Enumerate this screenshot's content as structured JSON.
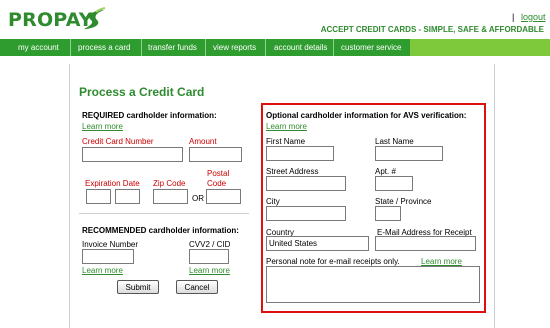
{
  "brand": {
    "name": "PROPAY",
    "tagline": "ACCEPT CREDIT CARDS - SIMPLE, SAFE & AFFORDABLE",
    "green": "#2e8b2e",
    "nav_green": "#2f9c2f",
    "accent_red": "#e01010",
    "error_red": "#cc0000"
  },
  "header": {
    "separator": "|",
    "logout": "logout"
  },
  "nav": {
    "items": [
      "my account",
      "process a card",
      "transfer funds",
      "view reports",
      "account details",
      "customer service"
    ]
  },
  "page": {
    "title": "Process a Credit Card"
  },
  "required": {
    "heading": "REQUIRED cardholder information:",
    "learn_more": "Learn more",
    "card_number_label": "Credit Card Number",
    "amount_label": "Amount",
    "expiration_label": "Expiration Date",
    "zip_label": "Zip Code",
    "postal_label_line1": "Postal",
    "postal_label_line2": "Code",
    "or_text": "OR"
  },
  "recommended": {
    "heading": "RECOMMENDED cardholder information:",
    "invoice_label": "Invoice Number",
    "cvv_label": "CVV2 / CID",
    "learn_more_invoice": "Learn more",
    "learn_more_cvv": "Learn more"
  },
  "buttons": {
    "submit": "Submit",
    "cancel": "Cancel"
  },
  "optional": {
    "heading": "Optional cardholder information for AVS verification:",
    "learn_more": "Learn more",
    "first_name_label": "First Name",
    "last_name_label": "Last Name",
    "street_label": "Street Address",
    "apt_label": "Apt. #",
    "city_label": "City",
    "state_label": "State / Province",
    "country_label": "Country",
    "country_value": "United States",
    "email_label": "E-Mail Address for Receipt",
    "note_label": "Personal note for e-mail receipts only.",
    "note_learn_more": "Learn more"
  }
}
